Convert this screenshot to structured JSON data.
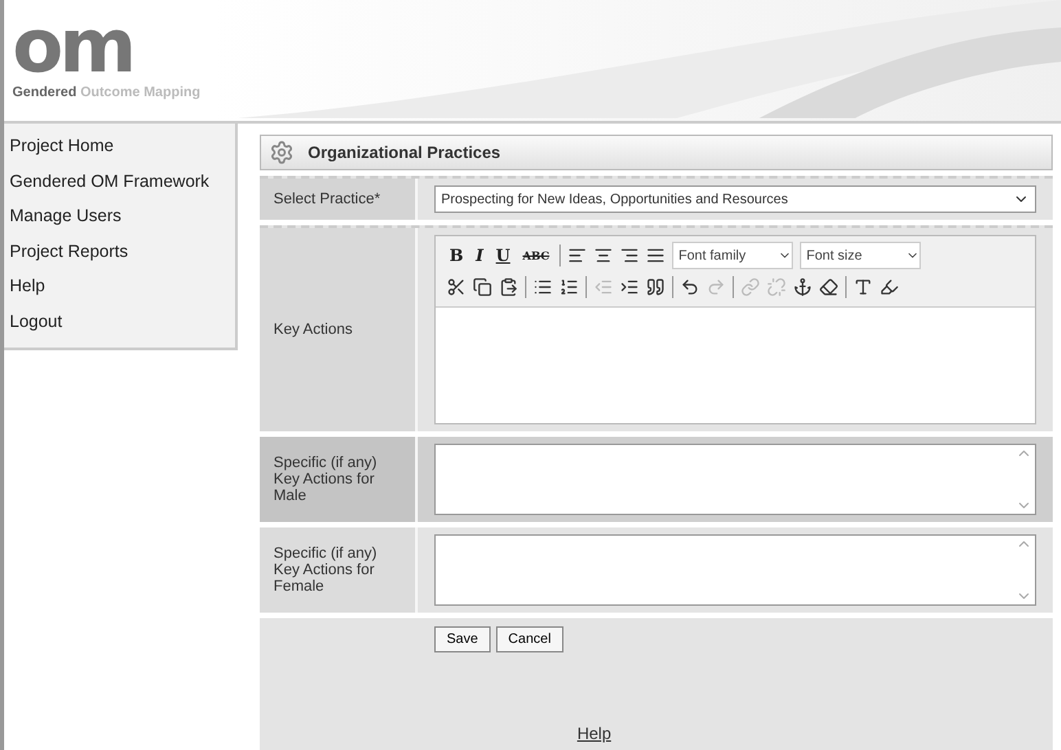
{
  "logo": {
    "mark": "om",
    "tagline": "**Gendered** Outcome Mapping"
  },
  "sidebar": {
    "items": [
      {
        "label": "Project Home"
      },
      {
        "label": "Gendered OM Framework"
      },
      {
        "label": "Manage Users"
      },
      {
        "label": "Project Reports"
      },
      {
        "label": "Help"
      },
      {
        "label": "Logout"
      }
    ]
  },
  "panel": {
    "title": "Organizational Practices"
  },
  "form": {
    "select_label": "Select Practice*",
    "select_value": "Prospecting for New Ideas, Opportunities and Resources",
    "key_actions_label": "Key Actions",
    "editor": {
      "format_buttons": [
        "B",
        "I",
        "U",
        "ABC"
      ],
      "font_family": "Font family",
      "font_size": "Font size",
      "row2": [
        {
          "disabled": false
        },
        {
          "disabled": false
        },
        {
          "disabled": false
        },
        {
          "disabled": false
        },
        {
          "disabled": false
        },
        {
          "disabled": true
        },
        {
          "disabled": false
        },
        {
          "disabled": false
        },
        {
          "disabled": false
        },
        {
          "disabled": true
        },
        {
          "disabled": true
        },
        {
          "disabled": true
        },
        {
          "disabled": false
        },
        {
          "disabled": false
        }
      ]
    },
    "textareas": [
      {
        "label": "Specific (if any) Key Actions for Male"
      },
      {
        "label": "Specific (if any) Key Actions for Female"
      }
    ],
    "buttons": [
      "Save",
      "Cancel"
    ],
    "help_link": "Help"
  }
}
